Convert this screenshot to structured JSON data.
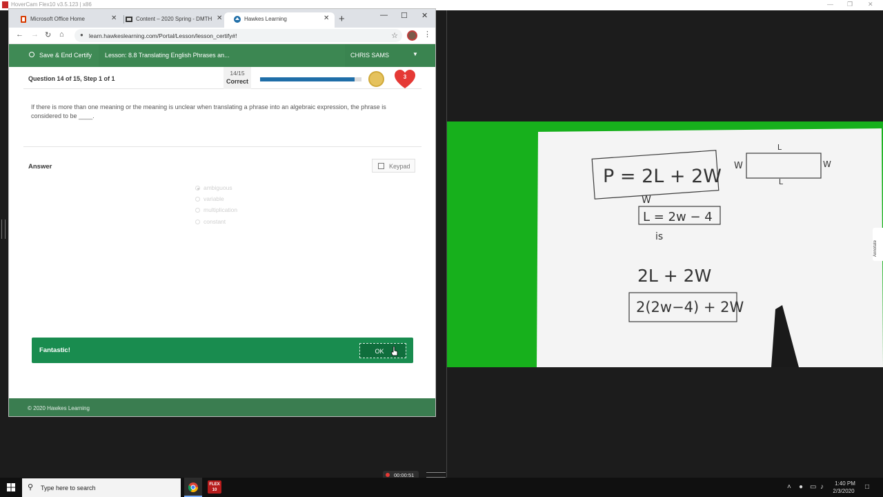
{
  "hovercam": {
    "title": "HoverCam Flex10 v3.5.123 | x86",
    "recording_time": "00:00:51"
  },
  "browser": {
    "tabs": [
      {
        "label": "Microsoft Office Home",
        "icon": "office-icon"
      },
      {
        "label": "Content – 2020 Spring - DMTH",
        "icon": "d2l-icon"
      },
      {
        "label": "Hawkes Learning",
        "icon": "hawkes-icon",
        "active": true
      }
    ],
    "url": "learn.hawkeslearning.com/Portal/Lesson/lesson_certify#!"
  },
  "hawkes": {
    "save_end": "Save & End Certify",
    "lesson_title": "Lesson: 8.8 Translating English Phrases an...",
    "user": "CHRIS SAMS",
    "question_label": "Question 14 of 15, Step 1 of 1",
    "score_fraction": "14/15",
    "score_label": "Correct",
    "progress": 0.933,
    "lives": "3",
    "question_text": "If there is more than one meaning or the meaning is unclear when translating a phrase into an algebraic expression, the phrase is considered to be ____.",
    "answer_label": "Answer",
    "keypad_label": "Keypad",
    "options": [
      {
        "label": "ambiguous",
        "selected": true
      },
      {
        "label": "variable",
        "selected": false
      },
      {
        "label": "multiplication",
        "selected": false
      },
      {
        "label": "constant",
        "selected": false
      }
    ],
    "feedback": "Fantastic!",
    "ok_label": "OK",
    "footer": "© 2020 Hawkes Learning",
    "accent": "#3c8752",
    "feedback_color": "#198c4f",
    "progress_color": "#1f6ea8"
  },
  "webcam": {
    "background": "#17b01c",
    "notes": {
      "formula": "P = 2L + 2W",
      "rect_top": "L",
      "rect_bottom": "L",
      "rect_left": "W",
      "rect_right": "W",
      "w_label": "W",
      "relation": "L = 2w − 4",
      "is_label": "is",
      "expression": "2L + 2W",
      "substituted": "2(2w−4) + 2W"
    },
    "annotate_label": "Annotate"
  },
  "taskbar": {
    "search_placeholder": "Type here to search",
    "time": "1:40 PM",
    "date": "2/3/2020"
  }
}
